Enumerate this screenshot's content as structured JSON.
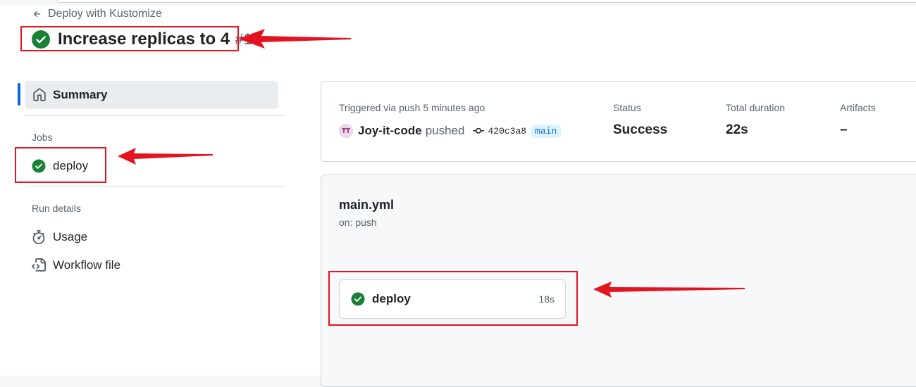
{
  "header": {
    "back_label": "Deploy with Kustomize",
    "run_title": "Increase replicas to 4",
    "run_number": "#13"
  },
  "sidebar": {
    "summary_label": "Summary",
    "jobs_heading": "Jobs",
    "jobs": [
      {
        "label": "deploy"
      }
    ],
    "run_details_heading": "Run details",
    "details": [
      {
        "label": "Usage"
      },
      {
        "label": "Workflow file"
      }
    ]
  },
  "summary": {
    "triggered_text": "Triggered via push 5 minutes ago",
    "user": "Joy-it-code",
    "action": "pushed",
    "commit_sha": "420c3a8",
    "branch": "main",
    "status_label": "Status",
    "status_value": "Success",
    "duration_label": "Total duration",
    "duration_value": "22s",
    "artifacts_label": "Artifacts",
    "artifacts_value": "–"
  },
  "workflow": {
    "file_name": "main.yml",
    "trigger": "on: push",
    "job_label": "deploy",
    "job_duration": "18s"
  },
  "colors": {
    "success_green": "#1a7f37",
    "accent_blue": "#0969da",
    "annotation_red": "#e3141f"
  },
  "icons": [
    "arrow-left-icon",
    "check-circle-icon",
    "home-icon",
    "stopwatch-icon",
    "workflow-file-icon",
    "git-commit-icon",
    "avatar-icon"
  ]
}
